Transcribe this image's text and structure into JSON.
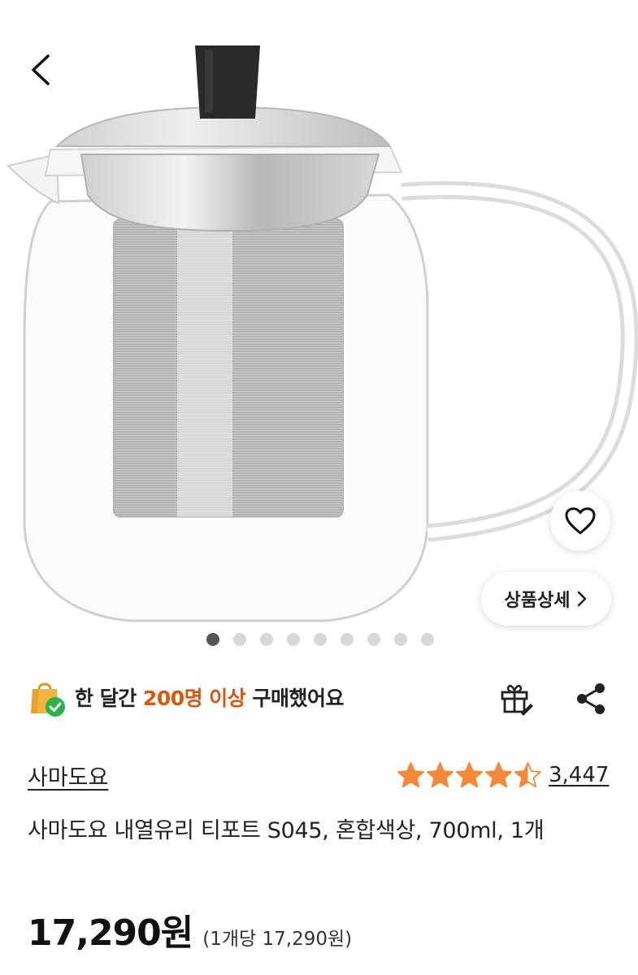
{
  "nav": {
    "back_icon": "chevron-left-icon"
  },
  "gallery": {
    "total_images": 9,
    "active_index": 0
  },
  "detail_button": {
    "label": "상품상세",
    "icon": "chevron-right-icon"
  },
  "wishlist": {
    "icon": "heart-outline-icon"
  },
  "social_proof": {
    "icon": "shopping-bag-check-icon",
    "prefix": "한 달간 ",
    "highlight": "200명 이상",
    "suffix": " 구매했어요",
    "highlight_color": "#d9570f"
  },
  "actions": {
    "gift_icon": "gift-icon",
    "share_icon": "share-icon"
  },
  "brand": {
    "name": "사마도요"
  },
  "rating": {
    "value": 4.5,
    "max": 5,
    "review_count": "3,447",
    "star_color": "#f5893a"
  },
  "product": {
    "title": "사마도요 내열유리 티포트 S045, 혼합색상, 700ml, 1개",
    "price": "17,290원",
    "unit_price": "(1개당 17,290원)"
  }
}
